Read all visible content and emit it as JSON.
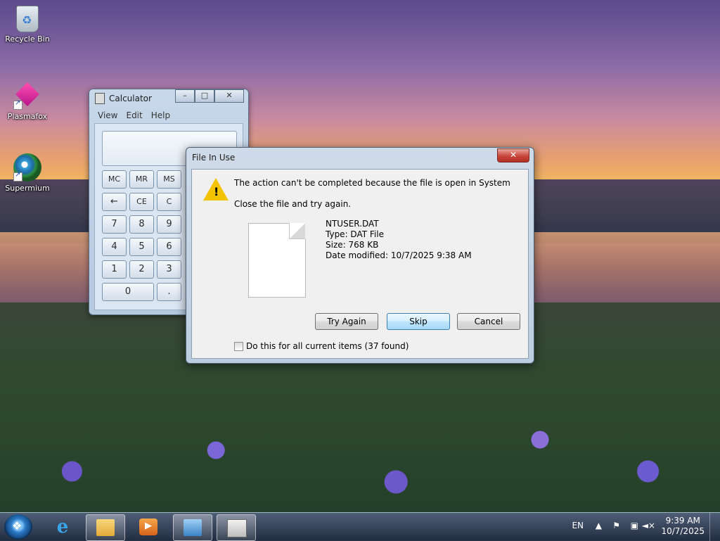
{
  "desktop": {
    "icons": [
      {
        "label": "Recycle Bin",
        "icon": "recycle-bin-icon"
      },
      {
        "label": "Plasmafox",
        "icon": "plasmafox-icon"
      },
      {
        "label": "Supermium",
        "icon": "supermium-icon"
      }
    ]
  },
  "calculator": {
    "title": "Calculator",
    "menu": [
      "View",
      "Edit",
      "Help"
    ],
    "window_controls": {
      "minimize": "–",
      "maximize": "□",
      "close": "✕"
    },
    "buttons": [
      "MC",
      "MR",
      "MS",
      "←",
      "CE",
      "C",
      "7",
      "8",
      "9",
      "4",
      "5",
      "6",
      "1",
      "2",
      "3",
      "0",
      "."
    ]
  },
  "dialog": {
    "title": "File In Use",
    "close_glyph": "✕",
    "message": "The action can't be completed because the file is open in System",
    "instruction": "Close the file and try again.",
    "file": {
      "name": "NTUSER.DAT",
      "type": "Type: DAT File",
      "size": "Size: 768 KB",
      "modified": "Date modified: 10/7/2025 9:38 AM"
    },
    "buttons": {
      "try_again": "Try Again",
      "skip": "Skip",
      "cancel": "Cancel"
    },
    "checkbox_label": "Do this for all current items (37 found)",
    "checkbox_checked": false
  },
  "taskbar": {
    "apps": [
      "internet-explorer",
      "windows-explorer",
      "media-player",
      "control-panel",
      "calculator"
    ],
    "tray": {
      "language": "EN",
      "time": "9:39 AM",
      "date": "10/7/2025"
    }
  }
}
